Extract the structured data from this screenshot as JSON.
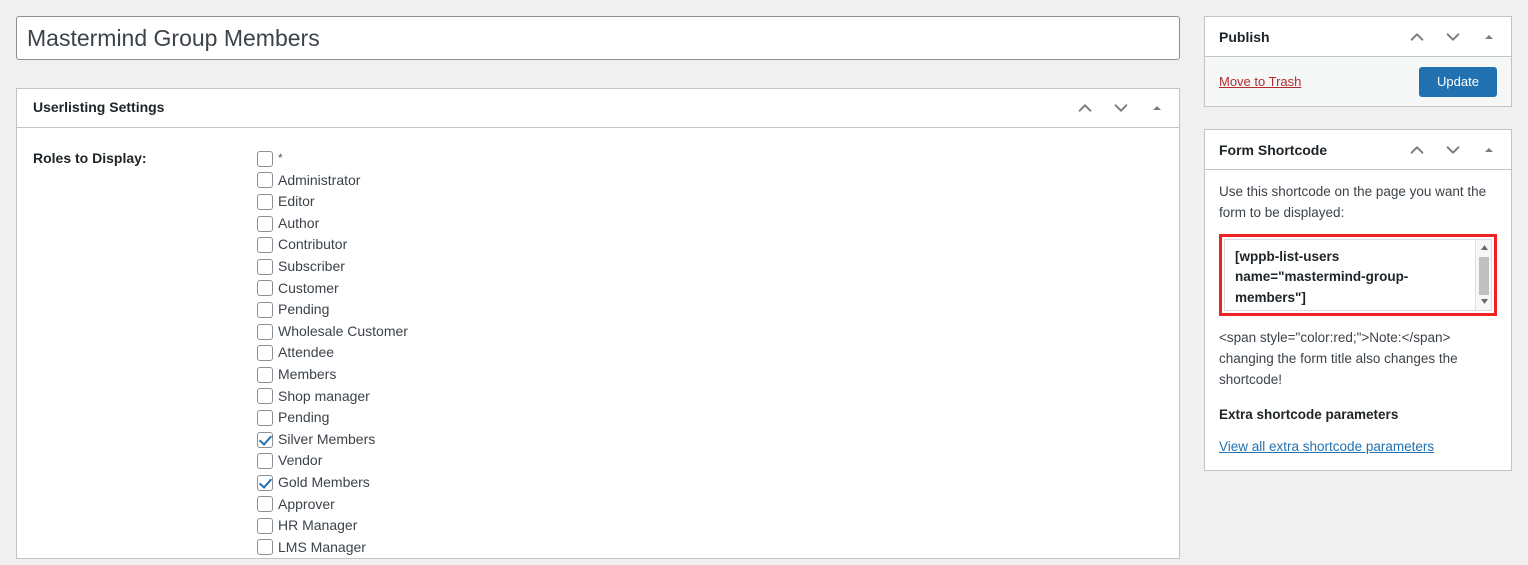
{
  "post_title": {
    "value": "Mastermind Group Members",
    "placeholder": "Add title"
  },
  "userlisting_panel": {
    "title": "Userlisting Settings",
    "roles_label": "Roles to Display:",
    "roles": [
      {
        "label": "*",
        "checked": false
      },
      {
        "label": "Administrator",
        "checked": false
      },
      {
        "label": "Editor",
        "checked": false
      },
      {
        "label": "Author",
        "checked": false
      },
      {
        "label": "Contributor",
        "checked": false
      },
      {
        "label": "Subscriber",
        "checked": false
      },
      {
        "label": "Customer",
        "checked": false
      },
      {
        "label": "Pending",
        "checked": false
      },
      {
        "label": "Wholesale Customer",
        "checked": false
      },
      {
        "label": "Attendee",
        "checked": false
      },
      {
        "label": "Members",
        "checked": false
      },
      {
        "label": "Shop manager",
        "checked": false
      },
      {
        "label": "Pending",
        "checked": false
      },
      {
        "label": "Silver Members",
        "checked": true
      },
      {
        "label": "Vendor",
        "checked": false
      },
      {
        "label": "Gold Members",
        "checked": true
      },
      {
        "label": "Approver",
        "checked": false
      },
      {
        "label": "HR Manager",
        "checked": false
      },
      {
        "label": "LMS Manager",
        "checked": false
      }
    ]
  },
  "publish_panel": {
    "title": "Publish",
    "trash_label": "Move to Trash",
    "update_label": "Update"
  },
  "shortcode_panel": {
    "title": "Form Shortcode",
    "intro": "Use this shortcode on the page you want the form to be displayed:",
    "shortcode_value": "[wppb-list-users name=\"mastermind-group-members\"]",
    "note": "<span style=\"color:red;\">Note:</span> changing the form title also changes the shortcode!",
    "extra_heading": "Extra shortcode parameters",
    "extra_link": "View all extra shortcode parameters"
  },
  "icons": {
    "move_up": "chevron-up-icon",
    "move_down": "chevron-down-icon",
    "toggle": "triangle-up-icon",
    "scroll_up": "scroll-up-arrow-icon",
    "scroll_down": "scroll-down-arrow-icon"
  },
  "colors": {
    "accent": "#2271b1",
    "danger": "#b32d2e",
    "highlight": "#ee2222",
    "page_bg": "#f0f0f1"
  }
}
